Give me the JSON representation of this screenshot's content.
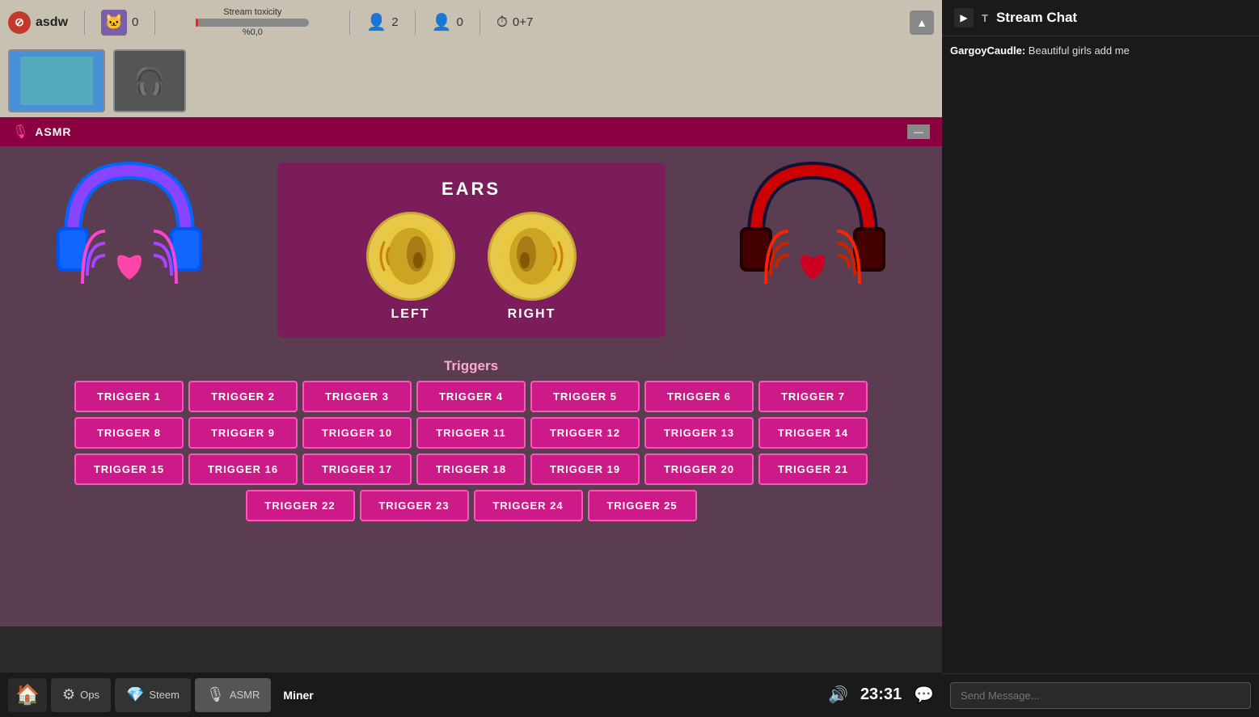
{
  "topbar": {
    "app_name": "asdw",
    "cat_count": "0",
    "toxicity_label": "Stream toxicity",
    "toxicity_pct": "%0,0",
    "viewers": "2",
    "anonymous": "0",
    "timer": "0+7"
  },
  "chat": {
    "title": "Stream Chat",
    "t_label": "T",
    "messages": [
      {
        "username": "GargoyCaudle",
        "text": "Beautiful girls add me"
      }
    ],
    "input_placeholder": "Send Message..."
  },
  "asmr": {
    "window_title": "ASMR",
    "ears_title": "EARS",
    "left_ear_label": "LEFT",
    "right_ear_label": "RIGHT",
    "triggers_label": "Triggers",
    "minimize_label": "—",
    "triggers": [
      "TRIGGER 1",
      "TRIGGER 2",
      "TRIGGER 3",
      "TRIGGER 4",
      "TRIGGER 5",
      "TRIGGER 6",
      "TRIGGER 7",
      "TRIGGER 8",
      "TRIGGER 9",
      "TRIGGER 10",
      "TRIGGER 11",
      "TRIGGER 12",
      "TRIGGER 13",
      "TRIGGER 14",
      "TRIGGER 15",
      "TRIGGER 16",
      "TRIGGER 17",
      "TRIGGER 18",
      "TRIGGER 19",
      "TRIGGER 20",
      "TRIGGER 21",
      "TRIGGER 22",
      "TRIGGER 23",
      "TRIGGER 24",
      "TRIGGER 25"
    ]
  },
  "taskbar": {
    "ops_label": "Ops",
    "steem_label": "Steem",
    "asmr_label": "ASMR",
    "miner_label": "Miner",
    "time": "23:31",
    "volume_icon": "🔊"
  }
}
